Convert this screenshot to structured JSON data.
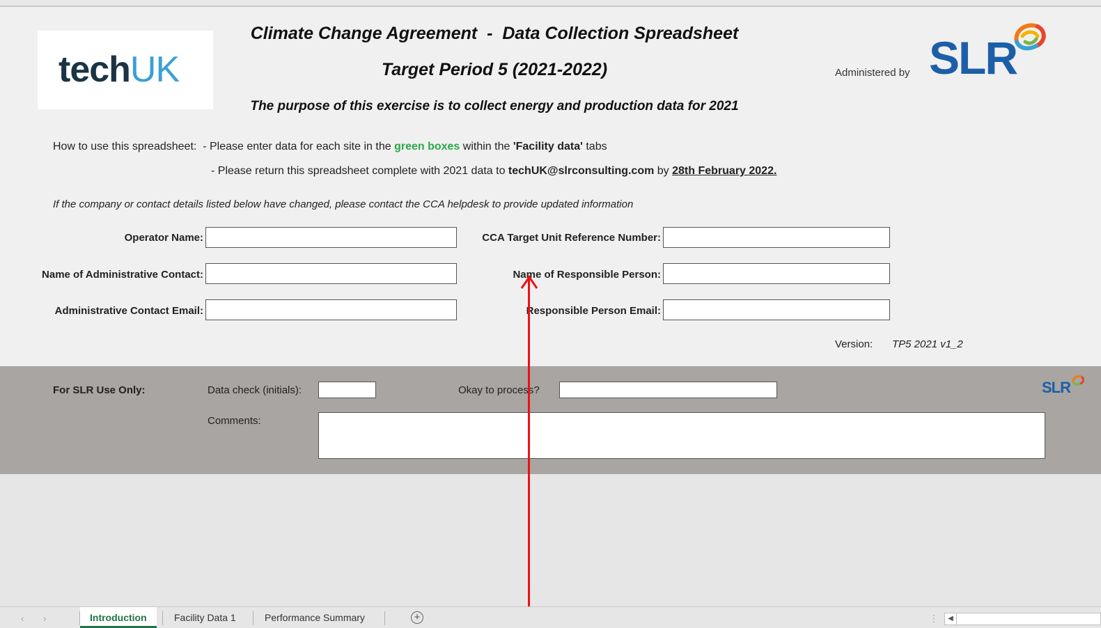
{
  "branding": {
    "logo_tech": "tech",
    "logo_uk": "UK",
    "administered_by": "Administered by",
    "slr_logo_text": "SLR",
    "slr_mini_logo_text": "SLR"
  },
  "header": {
    "title": "Climate Change Agreement  -  Data Collection Spreadsheet",
    "subtitle": "Target Period 5 (2021-2022)",
    "purpose": "The purpose of this exercise is to collect energy and production data for 2021"
  },
  "instructions": {
    "line1_prefix": "How to use this spreadsheet:  - Please enter data for each site in the ",
    "line1_green": "green boxes",
    "line1_mid": " within the ",
    "line1_bold": "'Facility data'",
    "line1_suffix": " tabs",
    "line2_prefix": "- Please return this spreadsheet complete with 2021 data to ",
    "line2_email": "techUK@slrconsulting.com",
    "line2_mid": " by ",
    "line2_date": "28th February 2022.",
    "note": "If the company or contact details listed below have changed, please contact the CCA helpdesk to provide updated information"
  },
  "form": {
    "operator_name_label": "Operator Name:",
    "operator_name_value": "",
    "admin_contact_label": "Name of Administrative Contact:",
    "admin_contact_value": "",
    "admin_email_label": "Administrative Contact Email:",
    "admin_email_value": "",
    "cca_ref_label": "CCA Target Unit Reference Number:",
    "cca_ref_value": "",
    "responsible_person_label": "Name of Responsible Person:",
    "responsible_person_value": "",
    "responsible_email_label": "Responsible Person Email:",
    "responsible_email_value": ""
  },
  "version": {
    "label": "Version:",
    "value": "TP5 2021 v1_2"
  },
  "slr_use": {
    "heading": "For SLR Use Only:",
    "data_check_label": "Data check (initials):",
    "data_check_value": "",
    "okay_label": "Okay to process?",
    "okay_value": "",
    "comments_label": "Comments:",
    "comments_value": ""
  },
  "sheet_tabs": [
    {
      "label": "Introduction",
      "active": true
    },
    {
      "label": "Facility Data 1",
      "active": false
    },
    {
      "label": "Performance Summary",
      "active": false
    }
  ],
  "colors": {
    "green_text": "#2ba84a",
    "slr_blue": "#1d5ea8",
    "active_tab": "#217346",
    "annotation_red": "#ee1111",
    "slr_band": "#a8a5a2"
  },
  "icons": {
    "add_sheet": "plus-circle-icon",
    "arrow": "arrow-up-icon",
    "scroll_left": "chevron-left-icon"
  }
}
